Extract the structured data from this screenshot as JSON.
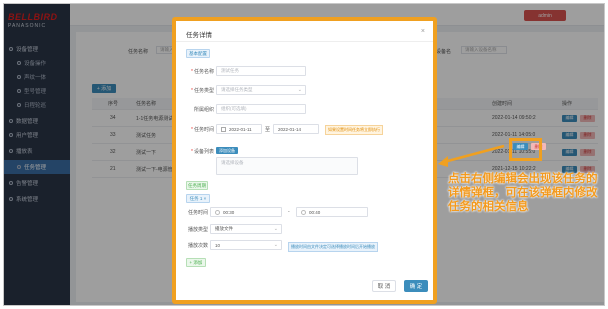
{
  "sidebar": {
    "logo_line1": "BELLBIRD",
    "logo_line2": "PANASONIC",
    "items": [
      {
        "label": "设备管理",
        "type": "group"
      },
      {
        "label": "设备操作",
        "type": "sub"
      },
      {
        "label": "声纹一体",
        "type": "sub"
      },
      {
        "label": "型号管理",
        "type": "sub"
      },
      {
        "label": "日程轮巡",
        "type": "sub"
      },
      {
        "label": "数据管理",
        "type": "group"
      },
      {
        "label": "用户管理",
        "type": "group"
      },
      {
        "label": "播放表",
        "type": "group"
      },
      {
        "label": "任务管理",
        "type": "active"
      },
      {
        "label": "告警管理",
        "type": "group"
      },
      {
        "label": "系统管理",
        "type": "group"
      }
    ]
  },
  "topbar": {
    "user_label": "admin"
  },
  "background_page": {
    "search_label1": "任务名称",
    "search_placeholder1": "请输入",
    "search_label2": "设备名",
    "search_placeholder2": "请输入设备名称",
    "add_label": "+ 添加",
    "columns": [
      "序号",
      "任务名称",
      "创建时间",
      "操作"
    ],
    "rows": [
      {
        "no": "34",
        "name": "1-1任务电源测试",
        "time": "2022-01-14 09:50:2"
      },
      {
        "no": "33",
        "name": "测试任务",
        "time": "2022-01-11 14:05:0"
      },
      {
        "no": "32",
        "name": "测试一下",
        "time": "2022-01-11 10:55:0"
      },
      {
        "no": "21",
        "name": "测试一下-电源管理",
        "time": "2021-12-15 10:22:2"
      }
    ],
    "edit_label": "编辑",
    "delete_label": "删除"
  },
  "modal": {
    "title": "任务详情",
    "close_symbol": "×",
    "basic_tag": "基本配置",
    "fields": {
      "task_name": {
        "label": "任务名称",
        "placeholder": "测试任务"
      },
      "task_type": {
        "label": "任务类型",
        "placeholder": "请选择任务类型"
      },
      "remark": {
        "label": "所属组织",
        "placeholder": "组织(可选填)"
      },
      "task_time": {
        "label": "任务时间",
        "start": "2022-01-11",
        "sep": "至",
        "end": "2022-01-14"
      },
      "device_list": {
        "label": "设备列表",
        "button": "添加设备",
        "placeholder": "请选择设备"
      }
    },
    "time_hint": "如果设置时间任务将立即执行",
    "schedule_tag": "任务周期",
    "period_tag": "任务 1 ×",
    "exec_time": {
      "label": "任务时间",
      "start": "00:30",
      "sep": "-",
      "end": "00:40"
    },
    "play_type": {
      "label": "播放类型",
      "value": "播放文件"
    },
    "play_count": {
      "label": "播放次数",
      "value": "10"
    },
    "play_hint": "播放时间由文件决定可选择播放时间后开始播放",
    "add_period": "+ 添加",
    "cancel_label": "取 消",
    "ok_label": "确 定"
  },
  "annotation": {
    "text": "点击右侧编辑会出现该任务的详情弹框，可在该弹框内修改任务的相关信息",
    "color": "#f39a1e"
  }
}
